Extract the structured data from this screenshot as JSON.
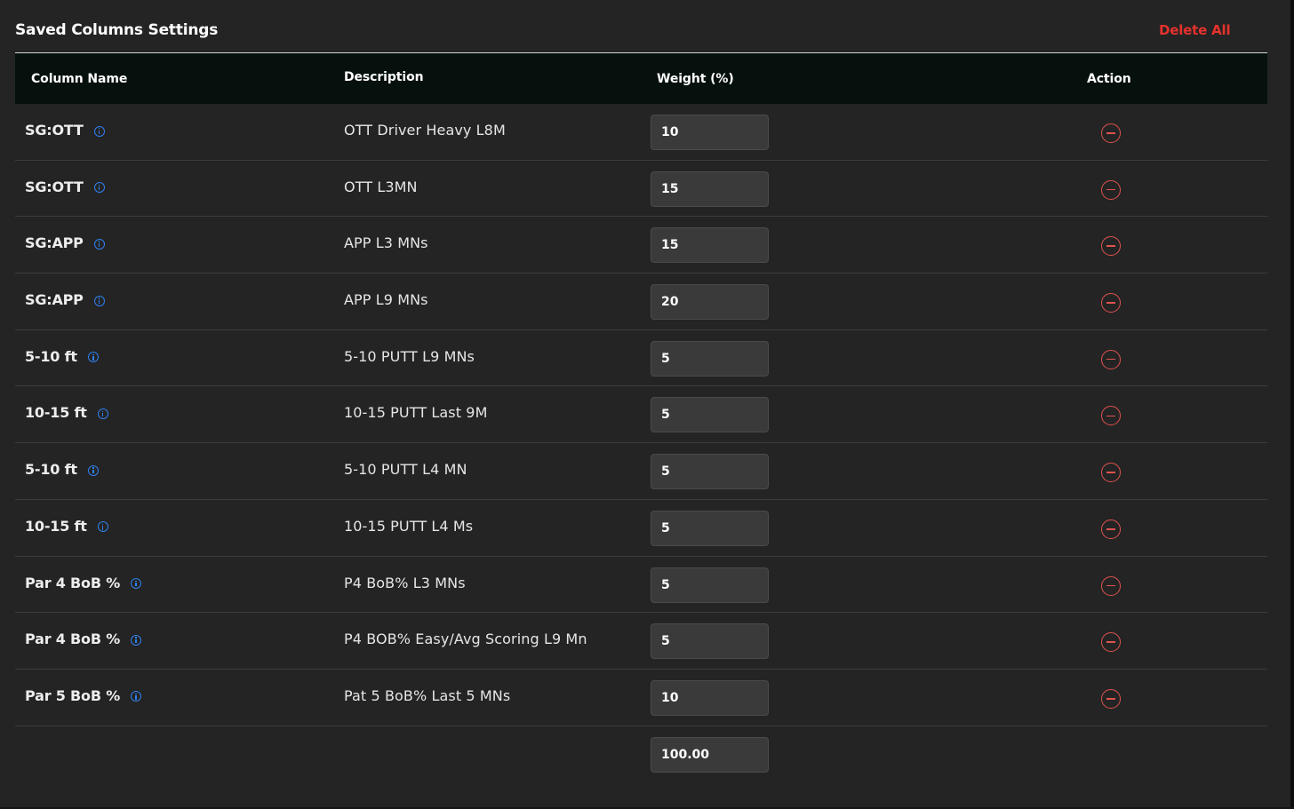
{
  "page": {
    "title": "Saved Columns Settings",
    "delete_all_label": "Delete All"
  },
  "table": {
    "headers": [
      "Column Name",
      "Description",
      "Weight (%)",
      "Action"
    ],
    "rows": [
      {
        "name": "SG:OTT",
        "description": "OTT Driver Heavy L8M",
        "weight": "10"
      },
      {
        "name": "SG:OTT",
        "description": "OTT L3MN",
        "weight": "15"
      },
      {
        "name": "SG:APP",
        "description": "APP L3 MNs",
        "weight": "15"
      },
      {
        "name": "SG:APP",
        "description": "APP L9 MNs",
        "weight": "20"
      },
      {
        "name": "5-10 ft",
        "description": "5-10 PUTT L9 MNs",
        "weight": "5"
      },
      {
        "name": "10-15 ft",
        "description": "10-15 PUTT Last 9M",
        "weight": "5"
      },
      {
        "name": "5-10 ft",
        "description": "5-10 PUTT L4 MN",
        "weight": "5"
      },
      {
        "name": "10-15 ft",
        "description": "10-15 PUTT L4 Ms",
        "weight": "5"
      },
      {
        "name": "Par 4 BoB %",
        "description": "P4 BoB% L3 MNs",
        "weight": "5"
      },
      {
        "name": "Par 4 BoB %",
        "description": "P4 BOB% Easy/Avg Scoring L9 Mn",
        "weight": "5"
      },
      {
        "name": "Par 5 BoB %",
        "description": "Pat 5 BoB% Last 5 MNs",
        "weight": "10"
      }
    ],
    "total_weight": "100.00"
  },
  "icons": {
    "info": "info-circle-icon",
    "remove": "minus-circle-icon"
  },
  "colors": {
    "background": "#242424",
    "header_background": "#06100c",
    "accent_red": "#e5322d",
    "info_blue": "#2f80ed",
    "input_background": "#3a3a3a"
  }
}
